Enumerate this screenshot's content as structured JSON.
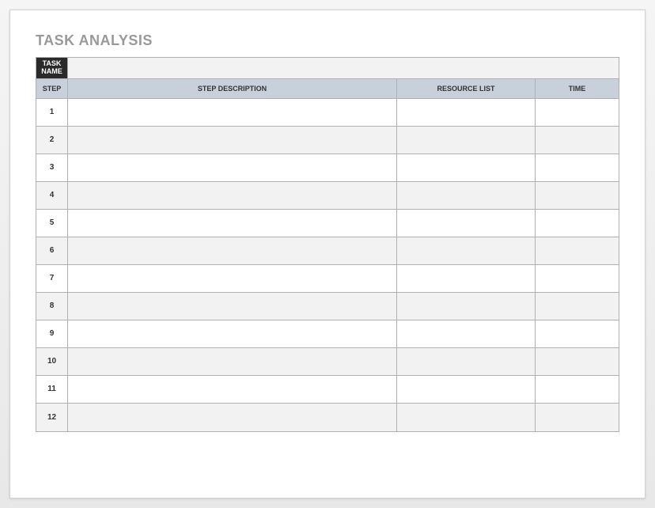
{
  "title": "TASK ANALYSIS",
  "taskNameLabel": "TASK NAME",
  "taskNameValue": "",
  "headers": {
    "step": "STEP",
    "description": "STEP DESCRIPTION",
    "resource": "RESOURCE LIST",
    "time": "TIME"
  },
  "rows": [
    {
      "step": "1",
      "description": "",
      "resource": "",
      "time": ""
    },
    {
      "step": "2",
      "description": "",
      "resource": "",
      "time": ""
    },
    {
      "step": "3",
      "description": "",
      "resource": "",
      "time": ""
    },
    {
      "step": "4",
      "description": "",
      "resource": "",
      "time": ""
    },
    {
      "step": "5",
      "description": "",
      "resource": "",
      "time": ""
    },
    {
      "step": "6",
      "description": "",
      "resource": "",
      "time": ""
    },
    {
      "step": "7",
      "description": "",
      "resource": "",
      "time": ""
    },
    {
      "step": "8",
      "description": "",
      "resource": "",
      "time": ""
    },
    {
      "step": "9",
      "description": "",
      "resource": "",
      "time": ""
    },
    {
      "step": "10",
      "description": "",
      "resource": "",
      "time": ""
    },
    {
      "step": "11",
      "description": "",
      "resource": "",
      "time": ""
    },
    {
      "step": "12",
      "description": "",
      "resource": "",
      "time": ""
    }
  ]
}
